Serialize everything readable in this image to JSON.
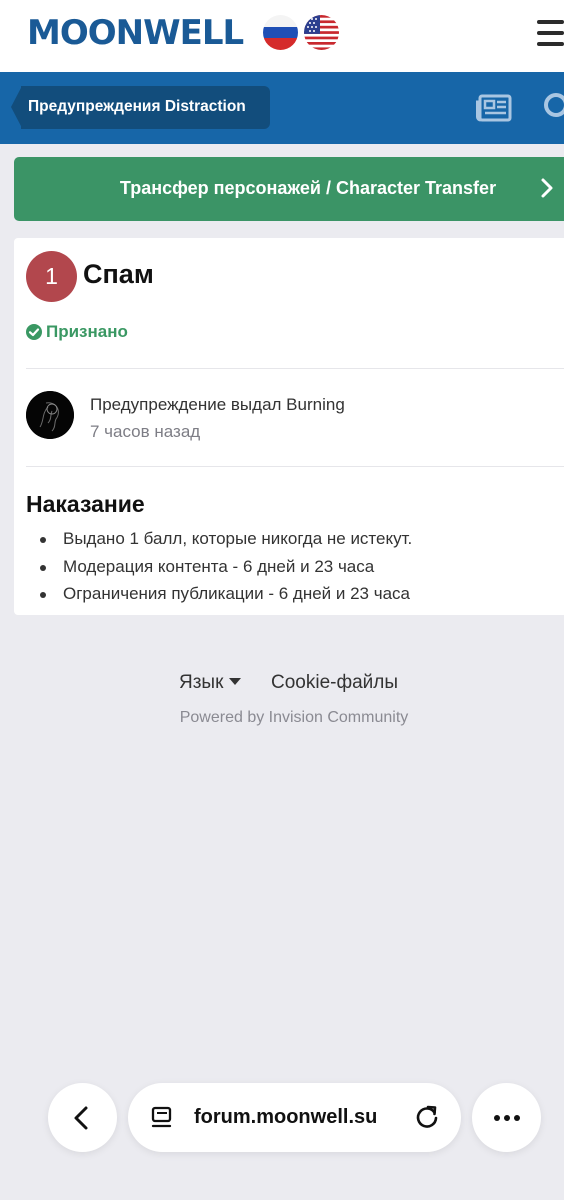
{
  "header": {
    "logo": "MOONWELL",
    "flags": [
      "russia-flag",
      "usa-flag"
    ],
    "menu_icon": "hamburger-menu-icon"
  },
  "navbar": {
    "breadcrumb": "Предупреждения Distraction",
    "icons": [
      "newspaper-icon",
      "search-icon"
    ],
    "color": "#1766a8"
  },
  "transfer_button": {
    "label": "Трансфер персонажей / Character Transfer",
    "color": "#3b9466"
  },
  "warning": {
    "points": "1",
    "title": "Спам",
    "status": "Признано",
    "issued_by": "Предупреждение выдал Burning",
    "issued_time": "7 часов назад",
    "punishment_title": "Наказание",
    "punishments": [
      "Выдано 1 балл, которые никогда не истекут.",
      "Модерация контента - 6 дней и 23 часа",
      "Ограничения публикации - 6 дней и 23 часа"
    ],
    "badge_color": "#b2474d",
    "status_color": "#3a9863"
  },
  "footer": {
    "language": "Язык",
    "cookies": "Cookie-файлы",
    "powered_by": "Powered by Invision Community"
  },
  "browser": {
    "url": "forum.moonwell.su"
  }
}
